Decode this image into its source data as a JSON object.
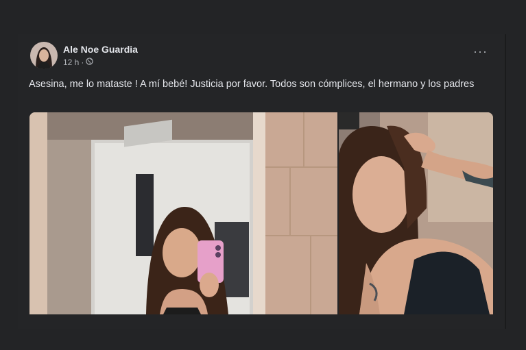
{
  "post": {
    "author": "Ale Noe Guardia",
    "time": "12 h",
    "separator": "·",
    "privacy_icon": "globe-icon",
    "more_icon": "more-options-icon",
    "more_label": "···",
    "text": "Asesina, me lo mataste ! A mí bebé! Justicia por favor. Todos son cómplices, el hermano y los padres"
  },
  "photos": [
    {
      "name": "photo-mirror-selfie"
    },
    {
      "name": "photo-portrait-selfie"
    }
  ]
}
